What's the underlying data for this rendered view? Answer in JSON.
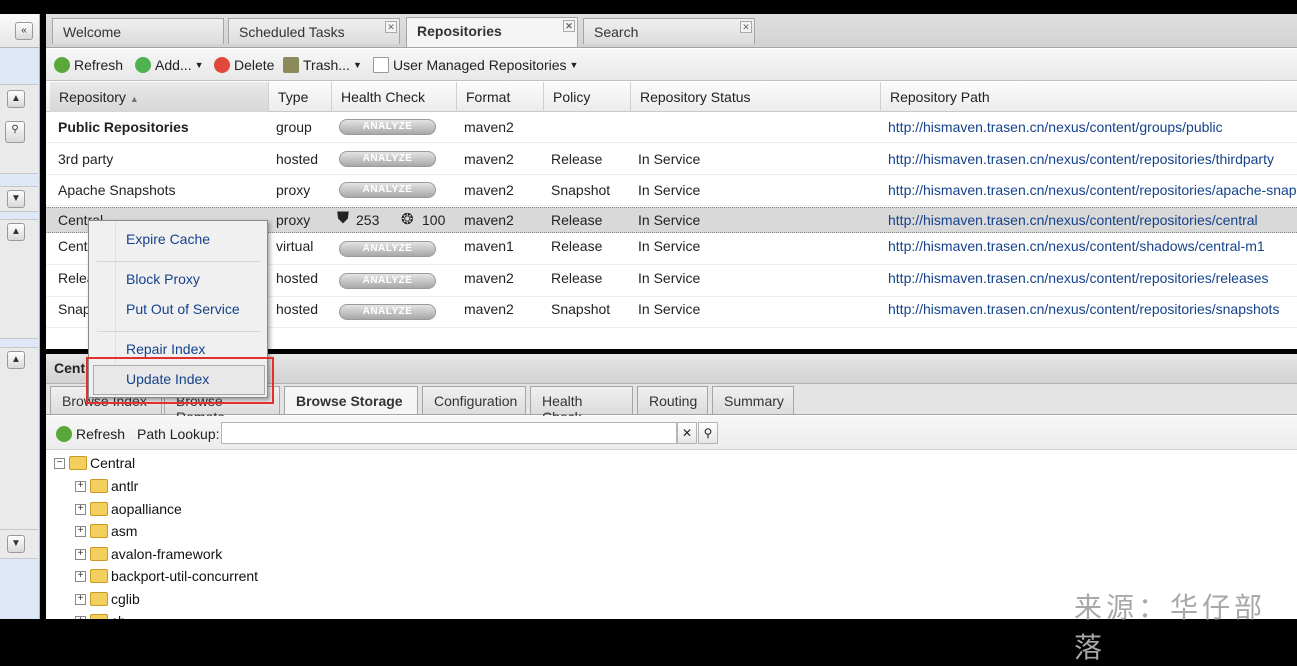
{
  "tabs": [
    {
      "label": "Welcome",
      "closable": false,
      "active": false
    },
    {
      "label": "Scheduled Tasks",
      "closable": true,
      "active": false
    },
    {
      "label": "Repositories",
      "closable": true,
      "active": true
    },
    {
      "label": "Search",
      "closable": true,
      "active": false
    }
  ],
  "toolbar": {
    "refresh": "Refresh",
    "add": "Add...",
    "delete": "Delete",
    "trash": "Trash...",
    "user_managed": "User Managed Repositories"
  },
  "grid": {
    "columns": [
      "Repository",
      "Type",
      "Health Check",
      "Format",
      "Policy",
      "Repository Status",
      "Repository Path"
    ],
    "sorted_column": "Repository",
    "analyze_label": "ANALYZE",
    "rows": [
      {
        "name": "Public Repositories",
        "type": "group",
        "health": "analyze",
        "format": "maven2",
        "policy": "",
        "status": "",
        "path": "http://hismaven.trasen.cn/nexus/content/groups/public",
        "bold": true
      },
      {
        "name": "3rd party",
        "type": "hosted",
        "health": "analyze",
        "format": "maven2",
        "policy": "Release",
        "status": "In Service",
        "path": "http://hismaven.trasen.cn/nexus/content/repositories/thirdparty"
      },
      {
        "name": "Apache Snapshots",
        "type": "proxy",
        "health": "analyze",
        "format": "maven2",
        "policy": "Snapshot",
        "status": "In Service",
        "path": "http://hismaven.trasen.cn/nexus/content/repositories/apache-snaps"
      },
      {
        "name": "Central",
        "type": "proxy",
        "health": "counts",
        "security_count": "253",
        "license_count": "100",
        "format": "maven2",
        "policy": "Release",
        "status": "In Service",
        "path": "http://hismaven.trasen.cn/nexus/content/repositories/central",
        "selected": true
      },
      {
        "name": "Centr",
        "type": "virtual",
        "health": "analyze",
        "format": "maven1",
        "policy": "Release",
        "status": "In Service",
        "path": "http://hismaven.trasen.cn/nexus/content/shadows/central-m1"
      },
      {
        "name": "Relea",
        "type": "hosted",
        "health": "analyze",
        "format": "maven2",
        "policy": "Release",
        "status": "In Service",
        "path": "http://hismaven.trasen.cn/nexus/content/repositories/releases"
      },
      {
        "name": "Snap",
        "type": "hosted",
        "health": "analyze",
        "format": "maven2",
        "policy": "Snapshot",
        "status": "In Service",
        "path": "http://hismaven.trasen.cn/nexus/content/repositories/snapshots"
      }
    ]
  },
  "context_menu": {
    "items": [
      "Expire Cache",
      "Block Proxy",
      "Put Out of Service",
      "Repair Index",
      "Update Index"
    ],
    "highlighted": "Update Index"
  },
  "detail": {
    "title": "Cent",
    "subtabs": [
      "Browse Index",
      "Browse Remote",
      "Browse Storage",
      "Configuration",
      "Health Check",
      "Routing",
      "Summary"
    ],
    "active_subtab": "Browse Storage",
    "refresh": "Refresh",
    "path_lookup_label": "Path Lookup:",
    "path_lookup_value": "",
    "tree_root": "Central",
    "tree_children": [
      "antlr",
      "aopalliance",
      "asm",
      "avalon-framework",
      "backport-util-concurrent",
      "cglib",
      "ch"
    ]
  },
  "watermark": "来源：华仔部落",
  "colors": {
    "link": "#15428b",
    "highlight_box": "#e0302f",
    "folder": "#f3cf5e"
  }
}
